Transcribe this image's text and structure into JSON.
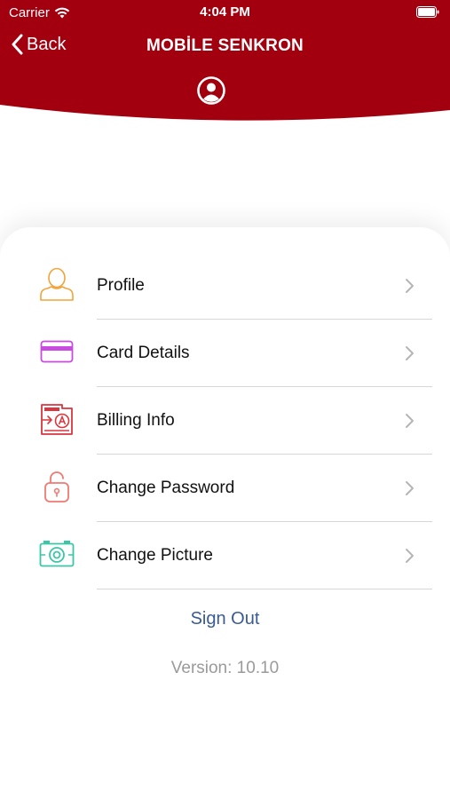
{
  "status_bar": {
    "carrier": "Carrier",
    "time": "4:04 PM",
    "icons": [
      "wifi-icon",
      "battery-icon"
    ]
  },
  "header": {
    "back_label": "Back",
    "title": "MOBİLE SENKRON",
    "avatar_icon": "user-circle-icon",
    "color": "#a3000f"
  },
  "menu": {
    "items": [
      {
        "label": "Profile",
        "icon": "user-icon",
        "color": "#f2a33a"
      },
      {
        "label": "Card Details",
        "icon": "credit-card-icon",
        "color": "#c94be0"
      },
      {
        "label": "Billing Info",
        "icon": "billing-document-icon",
        "color": "#d9363e"
      },
      {
        "label": "Change Password",
        "icon": "lock-icon",
        "color": "#f07a72"
      },
      {
        "label": "Change Picture",
        "icon": "camera-icon",
        "color": "#3cc6a8"
      }
    ]
  },
  "sign_out_label": "Sign Out",
  "version_text": "Version: 10.10",
  "colors": {
    "link": "#3a5a95",
    "muted": "#9a9a9a",
    "divider": "#d6d6d6"
  }
}
